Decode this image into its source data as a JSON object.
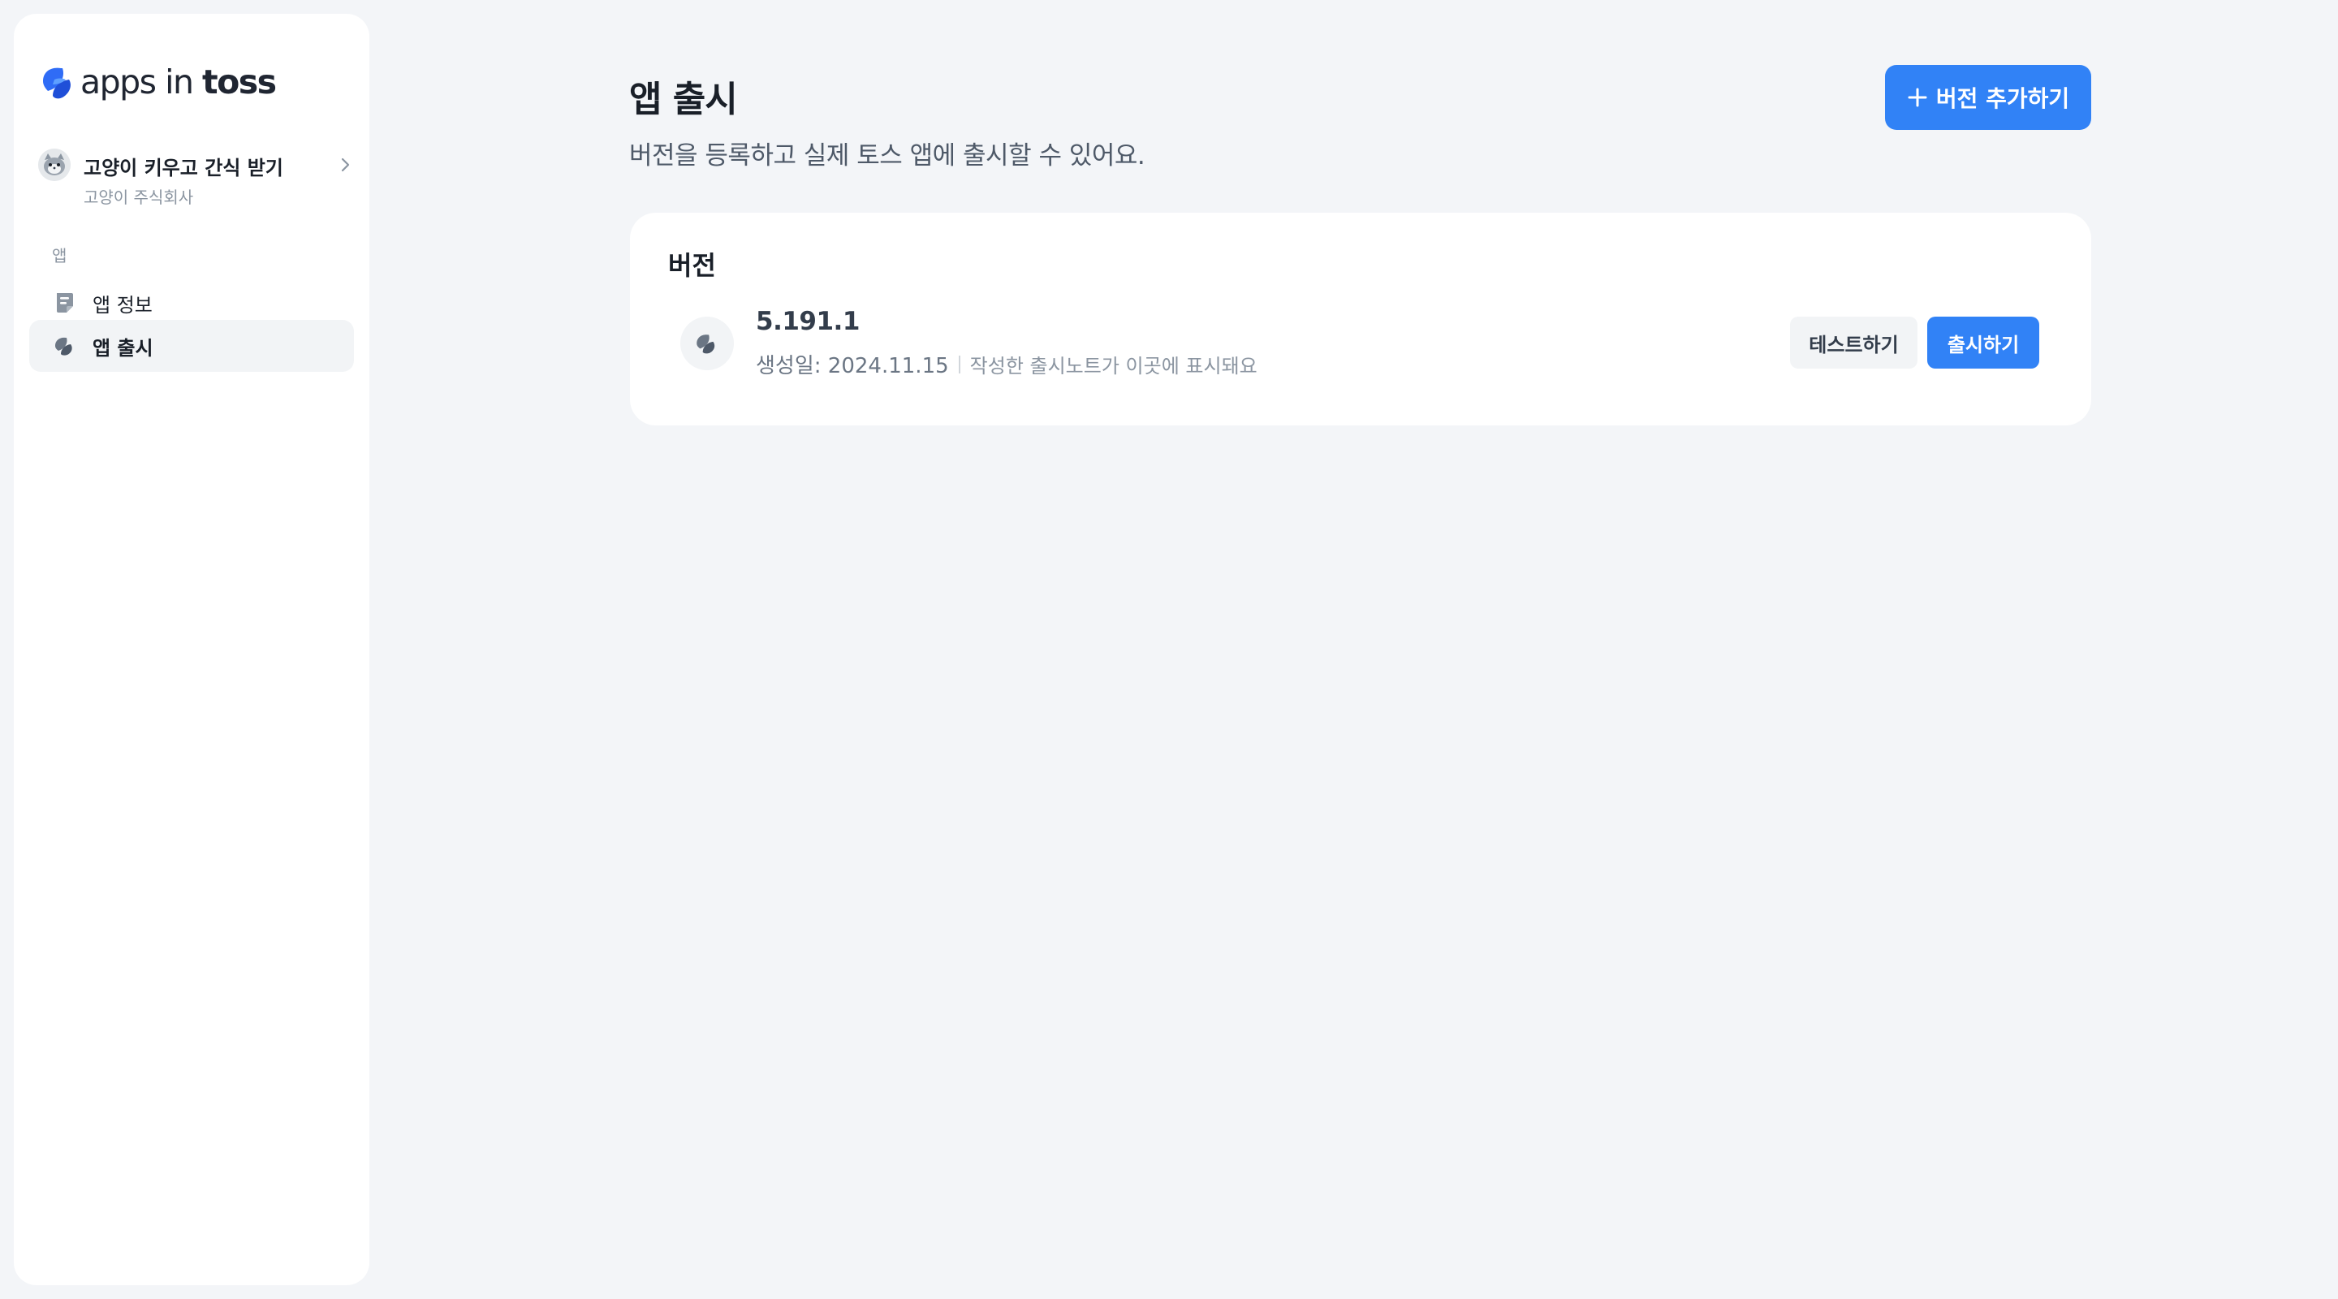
{
  "brand": {
    "logo_light": "apps in ",
    "logo_bold": "toss",
    "logo_icon": "toss-logo-icon"
  },
  "app": {
    "name": "고양이 키우고 간식 받기",
    "company": "고양이 주식회사",
    "avatar_icon": "cat-avatar-icon"
  },
  "sidebar": {
    "section_label": "앱",
    "items": [
      {
        "label": "앱 정보",
        "icon": "document-icon",
        "active": false
      },
      {
        "label": "앱 출시",
        "icon": "release-icon",
        "active": true
      }
    ]
  },
  "page": {
    "title": "앱 출시",
    "subtitle": "버전을 등록하고 실제 토스 앱에 출시할 수 있어요.",
    "add_button": "버전 추가하기"
  },
  "versions": {
    "title": "버전",
    "items": [
      {
        "number": "5.191.1",
        "created": "생성일: 2024.11.15",
        "note": "작성한 출시노트가 이곳에 표시돼요",
        "test_label": "테스트하기",
        "release_label": "출시하기"
      }
    ]
  },
  "colors": {
    "accent": "#3182f6",
    "background": "#f3f5f8",
    "card": "#ffffff",
    "text_primary": "#191f28",
    "text_secondary": "#8b95a1"
  }
}
